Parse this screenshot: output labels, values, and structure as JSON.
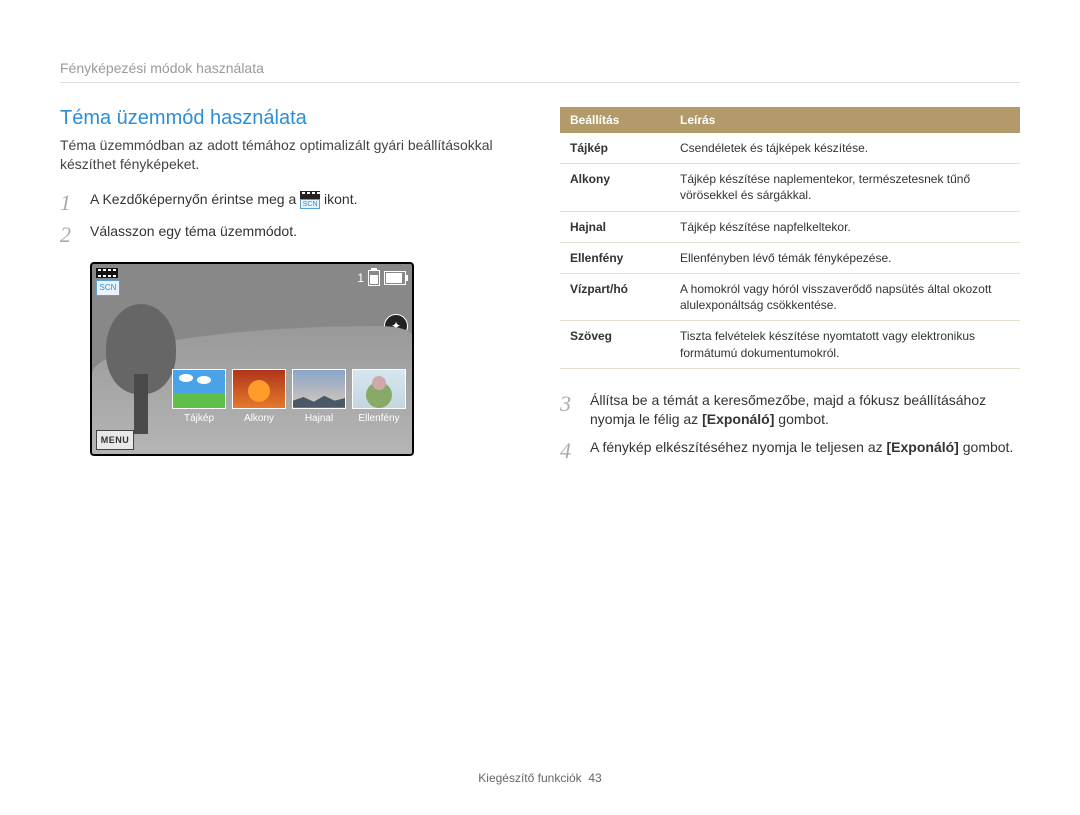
{
  "breadcrumb": "Fényképezési módok használata",
  "title": "Téma üzemmód használata",
  "intro": "Téma üzemmódban az adott témához optimalizált gyári beállításokkal készíthet fényképeket.",
  "steps": {
    "s1_pre": "A Kezdőképernyőn érintse meg a ",
    "s1_post": " ikont.",
    "s2": "Válasszon egy téma üzemmódot.",
    "s3_a": "Állítsa be a témát a keresőmezőbe, majd a fókusz beállításához nyomja le félig az ",
    "s3_bold": "[Exponáló]",
    "s3_b": " gombot.",
    "s4_a": "A fénykép elkészítéséhez nyomja le teljesen az ",
    "s4_bold": "[Exponáló]",
    "s4_b": " gombot."
  },
  "screen": {
    "scn_label": "SCN",
    "counter": "1",
    "menu": "MENU",
    "thumbs": [
      "Tájkép",
      "Alkony",
      "Hajnal",
      "Ellenfény"
    ]
  },
  "table": {
    "head": [
      "Beállítás",
      "Leírás"
    ],
    "rows": [
      [
        "Tájkép",
        "Csendéletek és tájképek készítése."
      ],
      [
        "Alkony",
        "Tájkép készítése naplementekor, természetesnek tűnő vörösekkel és sárgákkal."
      ],
      [
        "Hajnal",
        "Tájkép készítése napfelkeltekor."
      ],
      [
        "Ellenfény",
        "Ellenfényben lévő témák fényképezése."
      ],
      [
        "Vízpart/hó",
        "A homokról vagy hóról visszaverődő napsütés által okozott alulexponáltság csökkentése."
      ],
      [
        "Szöveg",
        "Tiszta felvételek készítése nyomtatott vagy elektronikus formátumú dokumentumokról."
      ]
    ]
  },
  "footer": {
    "label": "Kiegészítő funkciók",
    "page": "43"
  }
}
